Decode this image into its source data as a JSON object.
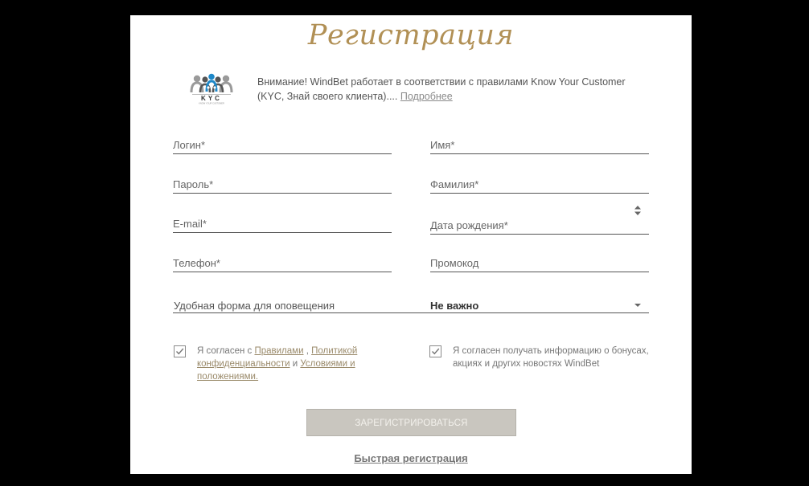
{
  "title": "Регистрация",
  "kyc": {
    "logo_icon": "kyc-people-logo",
    "logo_text": "KYC",
    "notice_text": "Внимание! WindBet работает в соответствии с правилами Know Your Customer (KYC, Знай своего клиента)....",
    "notice_link": "Подробнее"
  },
  "form": {
    "login_placeholder": "Логин*",
    "first_name_placeholder": "Имя*",
    "password_placeholder": "Пароль*",
    "last_name_placeholder": "Фамилия*",
    "email_placeholder": "E-mail*",
    "birth_date_placeholder": "Дата рождения*",
    "phone_placeholder": "Телефон*",
    "promo_placeholder": "Промокод",
    "notify_label": "Удобная форма для оповещения",
    "notify_value": "Не важно"
  },
  "agreements": {
    "terms": {
      "checked": true,
      "prefix": "Я согласен с ",
      "rules_link": "Правилами",
      "sep1": " , ",
      "privacy_link": "Политикой конфиденциальности",
      "sep2": " и ",
      "conditions_link": "Условиями и положениями."
    },
    "news": {
      "checked": true,
      "text": "Я согласен получать информацию о бонусах, акциях и других новостях WindBet"
    }
  },
  "submit_label": "ЗАРЕГИСТРИРОВАТЬСЯ",
  "quick_registration_label": "Быстрая регистрация",
  "colors": {
    "backdrop": "#000000",
    "title_gold": "#b19055",
    "button_bg": "#c9c6bf",
    "kyc_blue": "#1e88c8",
    "kyc_grey": "#8f8f8f"
  }
}
